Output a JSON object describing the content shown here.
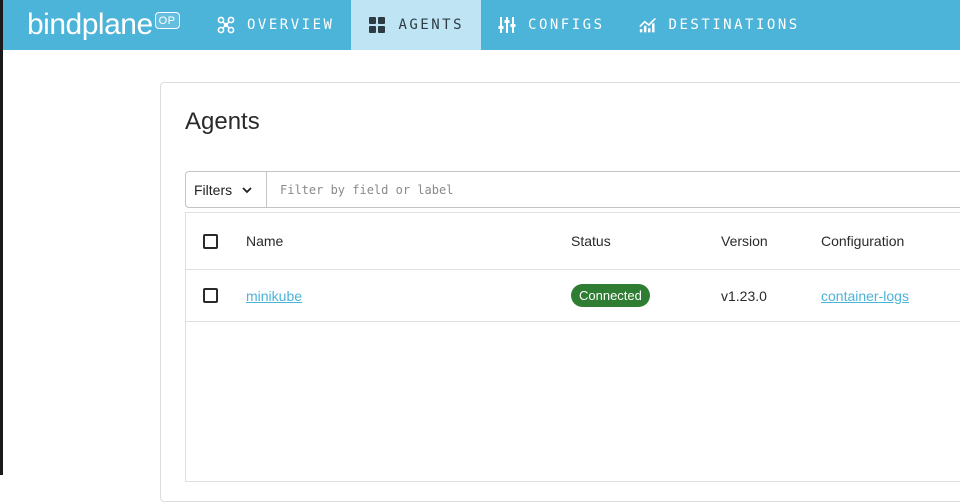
{
  "brand": {
    "name": "bindplane",
    "badge": "OP"
  },
  "nav": {
    "items": [
      {
        "label": "OVERVIEW",
        "icon": "overview-icon"
      },
      {
        "label": "AGENTS",
        "icon": "grid-icon",
        "active": true
      },
      {
        "label": "CONFIGS",
        "icon": "sliders-icon"
      },
      {
        "label": "DESTINATIONS",
        "icon": "chart-icon"
      }
    ]
  },
  "page": {
    "title": "Agents"
  },
  "filters": {
    "label": "Filters",
    "placeholder": "Filter by field or label"
  },
  "table": {
    "columns": [
      "Name",
      "Status",
      "Version",
      "Configuration"
    ],
    "rows": [
      {
        "name": "minikube",
        "status": "Connected",
        "version": "v1.23.0",
        "configuration": "container-logs"
      }
    ]
  },
  "colors": {
    "topbar": "#4cb3d9",
    "active_nav": "#bfe4f3",
    "link": "#4cb3d9",
    "status_connected": "#2e7d32"
  }
}
